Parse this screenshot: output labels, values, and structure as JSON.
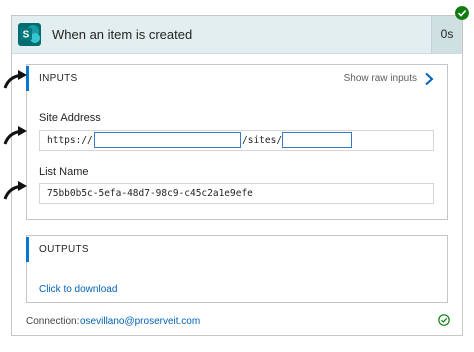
{
  "header": {
    "title": "When an item is created",
    "duration": "0s"
  },
  "inputs": {
    "section_title": "INPUTS",
    "raw_link": "Show raw inputs",
    "site_address_label": "Site Address",
    "site_address_prefix": "https://",
    "site_address_middle": "/sites/",
    "list_name_label": "List Name",
    "list_name_value": "75bb0b5c-5efa-48d7-98c9-c45c2a1e9efe"
  },
  "outputs": {
    "section_title": "OUTPUTS",
    "download_link": "Click to download"
  },
  "footer": {
    "connection_label": "Connection:",
    "connection_value": "osevillano@proserveit.com"
  },
  "colors": {
    "accent": "#0078d4",
    "success": "#107c10",
    "header_bg": "#e3eef0"
  }
}
